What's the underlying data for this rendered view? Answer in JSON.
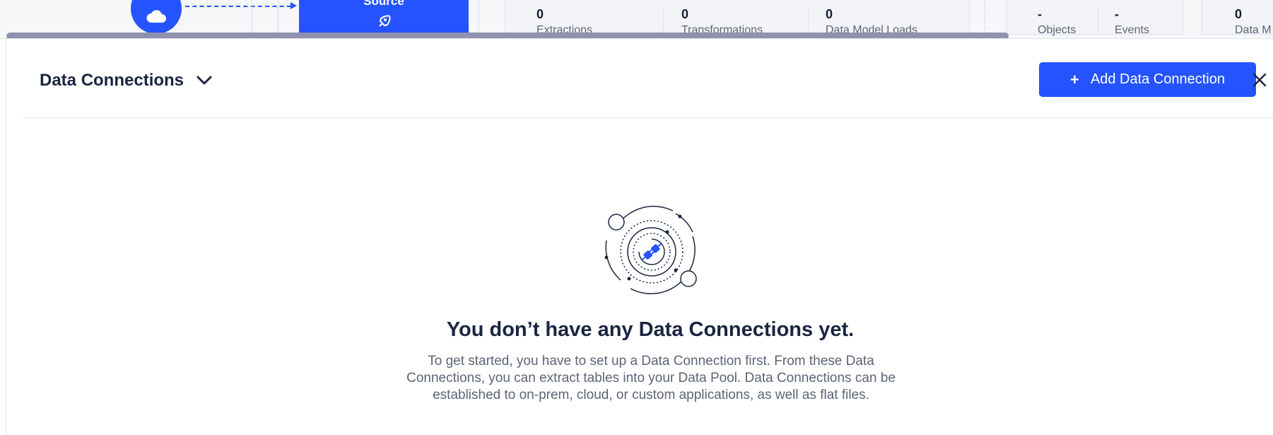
{
  "pipeline": {
    "source_label": "Source",
    "stats_group_1": [
      {
        "value": "0",
        "label": "Extractions"
      },
      {
        "value": "0",
        "label": "Transformations"
      },
      {
        "value": "0",
        "label": "Data Model Loads"
      }
    ],
    "stats_group_2": [
      {
        "value": "-",
        "label": "Objects"
      },
      {
        "value": "-",
        "label": "Events"
      }
    ],
    "stats_group_3": [
      {
        "value": "0",
        "label": "Data M"
      }
    ]
  },
  "panel": {
    "title": "Data Connections",
    "add_button_label": "Add Data Connection",
    "add_button_plus": "+"
  },
  "empty_state": {
    "title": "You don’t have any Data Connections yet.",
    "description": "To get started, you have to set up a Data Connection first. From these Data Connections, you can extract tables into your Data Pool. Data Connections can be established to on-prem, cloud, or custom applications, as well as flat files."
  },
  "colors": {
    "accent": "#2453ff",
    "title": "#1a2540",
    "muted": "#5c6477"
  }
}
